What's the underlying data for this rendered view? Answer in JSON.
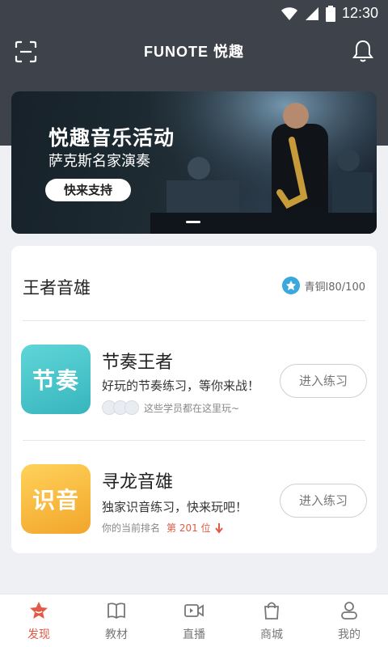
{
  "status": {
    "time": "12:30"
  },
  "appbar": {
    "logo": "FUNOTE 悦趣"
  },
  "banner": {
    "title": "悦趣音乐活动",
    "subtitle": "萨克斯名家演奏",
    "cta": "快来支持"
  },
  "section": {
    "title": "王者音雄",
    "rank": "青铜l80/100"
  },
  "games": [
    {
      "tile_text": "节奏",
      "name": "节奏王者",
      "desc": "好玩的节奏练习，等你来战！",
      "meta": "这些学员都在这里玩~",
      "button": "进入练习",
      "tile_color": "#44c7cc"
    },
    {
      "tile_text": "识音",
      "name": "寻龙音雄",
      "desc": "独家识音练习，快来玩吧！",
      "meta_prefix": "你的当前排名",
      "meta_rank": "第 201 位",
      "button": "进入练习",
      "tile_color": "#f6b63a"
    }
  ],
  "tabs": [
    {
      "label": "发现",
      "icon": "star-icon",
      "active": true
    },
    {
      "label": "教材",
      "icon": "book-icon",
      "active": false
    },
    {
      "label": "直播",
      "icon": "video-icon",
      "active": false
    },
    {
      "label": "商城",
      "icon": "bag-icon",
      "active": false
    },
    {
      "label": "我的",
      "icon": "user-icon",
      "active": false
    }
  ],
  "colors": {
    "accent": "#e25a45",
    "topbar": "#3d424b"
  }
}
